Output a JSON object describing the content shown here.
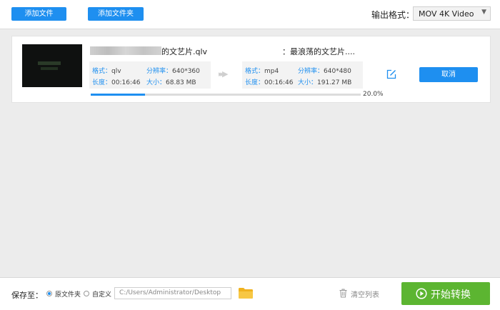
{
  "toolbar": {
    "add_file": "添加文件",
    "add_folder": "添加文件夹",
    "output_format_label": "输出格式：",
    "output_format_value": "MOV  4K Video"
  },
  "task": {
    "source_name_suffix": "的文艺片.qlv",
    "output_name": "：最浪荡的文艺片....",
    "source": {
      "format_key": "格式：",
      "format_val": "qlv",
      "res_key": "分辨率：",
      "res_val": "640*360",
      "len_key": "长度：",
      "len_val": "00:16:46",
      "size_key": "大小：",
      "size_val": "68.83 MB"
    },
    "output": {
      "format_key": "格式：",
      "format_val": "mp4",
      "res_key": "分辨率：",
      "res_val": "640*480",
      "len_key": "长度：",
      "len_val": "00:16:46",
      "size_key": "大小：",
      "size_val": "191.27 MB"
    },
    "cancel": "取消",
    "progress_text": "20.0%",
    "progress_fraction": 0.2
  },
  "bottom": {
    "save_to": "保存至：",
    "radio_source_folder": "原文件夹",
    "radio_custom": "自定义",
    "path": "C:/Users/Administrator/Desktop",
    "clear_list": "清空列表",
    "start": "开始转换"
  },
  "colors": {
    "accent": "#1e8ff0",
    "start": "#5cb531"
  }
}
